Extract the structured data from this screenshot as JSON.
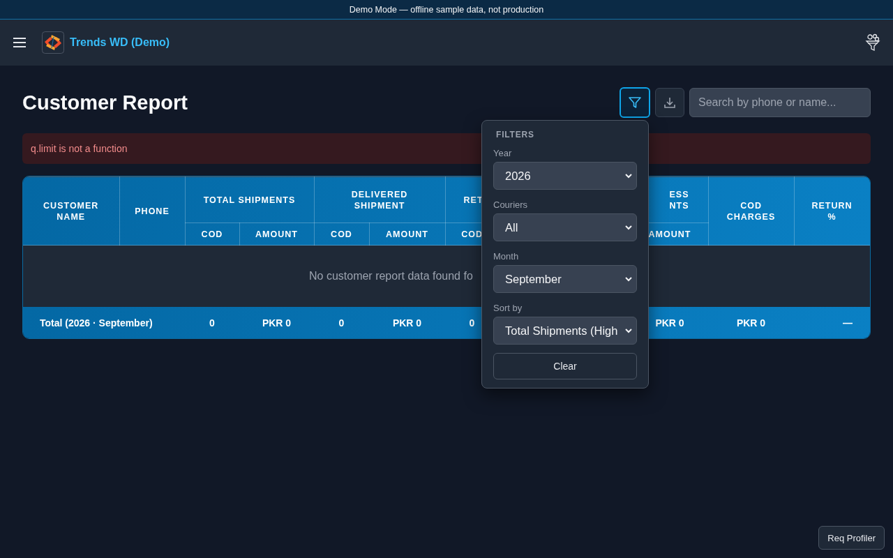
{
  "banner": {
    "text": "Demo Mode — offline sample data, not production"
  },
  "navbar": {
    "title": "Trends WD (Demo)"
  },
  "page": {
    "title": "Customer Report",
    "filter_button": {
      "active": true
    },
    "search": {
      "placeholder": "Search by phone or name..."
    }
  },
  "error": {
    "message": "q.limit is not a function"
  },
  "table": {
    "columns": [
      {
        "label": "CUSTOMER NAME",
        "kind": "single"
      },
      {
        "label": "PHONE",
        "kind": "single"
      },
      {
        "label": "TOTAL SHIPMENTS",
        "kind": "group",
        "sub": [
          "COD",
          "AMOUNT"
        ]
      },
      {
        "label": "DELIVERED SHIPMENT",
        "kind": "group",
        "sub": [
          "COD",
          "AMOUNT"
        ]
      },
      {
        "label": "RET",
        "kind": "cut-right",
        "sub": [
          "COD"
        ]
      },
      {
        "label": "ESS\nNTS",
        "kind": "cut-left",
        "sub": [
          "AMOUNT"
        ]
      },
      {
        "label": "COD CHARGES",
        "kind": "single"
      },
      {
        "label": "RETURN %",
        "kind": "single"
      }
    ],
    "empty_message": "No customer report data found fo",
    "total_row": [
      "Total (2026 · September)",
      "0",
      "PKR 0",
      "0",
      "PKR 0",
      "0",
      "PKR 0",
      "PKR 0",
      "—"
    ]
  },
  "filters": {
    "title": "FILTERS",
    "fields": [
      {
        "label": "Year",
        "value": "2026"
      },
      {
        "label": "Couriers",
        "value": "All"
      },
      {
        "label": "Month",
        "value": "September"
      },
      {
        "label": "Sort by",
        "value": "Total Shipments (High"
      }
    ],
    "clear": "Clear"
  },
  "profiler": {
    "label": "Req Profiler"
  }
}
